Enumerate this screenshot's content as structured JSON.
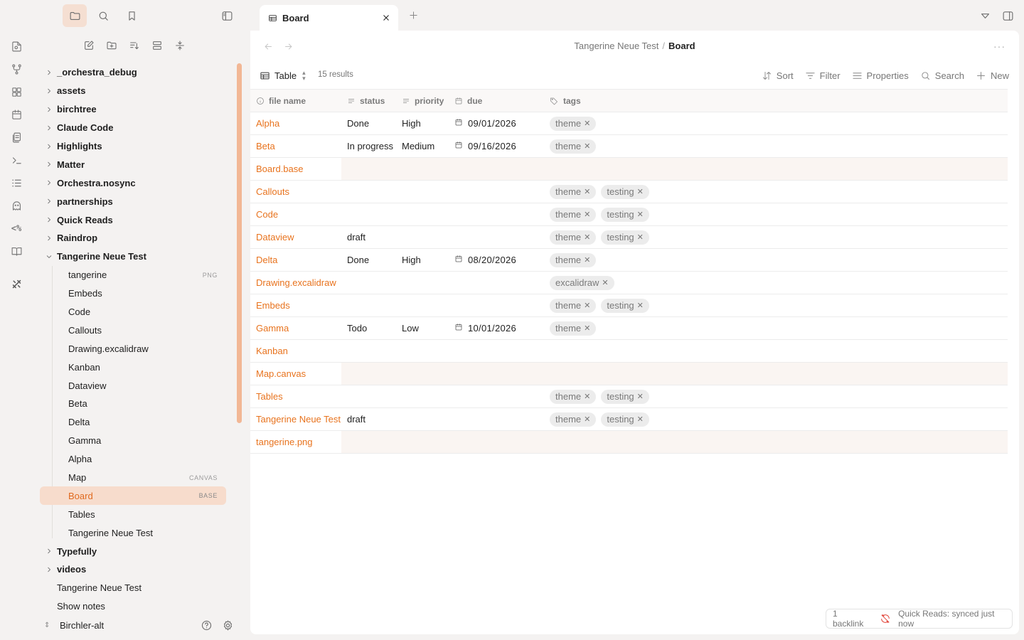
{
  "ribbon": {
    "icons": [
      "new-note-icon",
      "graph-icon",
      "dashboard-icon",
      "calendar-icon",
      "templates-icon",
      "command-icon",
      "outline-icon",
      "ghost-icon",
      "code-percent-icon",
      "book-icon",
      "tools-icon"
    ],
    "code_percent_text": "<%"
  },
  "sidebar": {
    "top_icons": [
      "folder-icon",
      "search-icon",
      "bookmark-icon"
    ],
    "tree": [
      {
        "type": "folder",
        "label": "_orchestra_debug"
      },
      {
        "type": "folder",
        "label": "assets"
      },
      {
        "type": "folder",
        "label": "birchtree"
      },
      {
        "type": "folder",
        "label": "Claude Code"
      },
      {
        "type": "folder",
        "label": "Highlights"
      },
      {
        "type": "folder",
        "label": "Matter"
      },
      {
        "type": "folder",
        "label": "Orchestra.nosync"
      },
      {
        "type": "folder",
        "label": "partnerships"
      },
      {
        "type": "folder",
        "label": "Quick Reads"
      },
      {
        "type": "folder",
        "label": "Raindrop"
      },
      {
        "type": "folder-open",
        "label": "Tangerine Neue Test"
      },
      {
        "type": "child",
        "label": "tangerine",
        "tag": "PNG"
      },
      {
        "type": "child",
        "label": "Embeds"
      },
      {
        "type": "child",
        "label": "Code"
      },
      {
        "type": "child",
        "label": "Callouts"
      },
      {
        "type": "child",
        "label": "Drawing.excalidraw"
      },
      {
        "type": "child",
        "label": "Kanban"
      },
      {
        "type": "child",
        "label": "Dataview"
      },
      {
        "type": "child",
        "label": "Beta"
      },
      {
        "type": "child",
        "label": "Delta"
      },
      {
        "type": "child",
        "label": "Gamma"
      },
      {
        "type": "child",
        "label": "Alpha"
      },
      {
        "type": "child",
        "label": "Map",
        "tag": "CANVAS"
      },
      {
        "type": "child",
        "label": "Board",
        "tag": "BASE",
        "selected": true
      },
      {
        "type": "child",
        "label": "Tables"
      },
      {
        "type": "child",
        "label": "Tangerine Neue Test"
      },
      {
        "type": "folder",
        "label": "Typefully"
      },
      {
        "type": "folder",
        "label": "videos"
      },
      {
        "type": "root-file",
        "label": "Tangerine Neue Test"
      },
      {
        "type": "root-file",
        "label": "Show notes"
      }
    ],
    "vault_name": "Birchler-alt"
  },
  "tab": {
    "label": "Board"
  },
  "breadcrumb": {
    "parent": "Tangerine Neue Test",
    "sep": "/",
    "current": "Board"
  },
  "more_label": "···",
  "toolbar": {
    "view_label": "Table",
    "results": "15 results",
    "sort": "Sort",
    "filter": "Filter",
    "properties": "Properties",
    "search": "Search",
    "new": "New"
  },
  "table": {
    "headers": {
      "name": "file name",
      "status": "status",
      "priority": "priority",
      "due": "due",
      "tags": "tags"
    },
    "rows": [
      {
        "name": "Alpha",
        "status": "Done",
        "priority": "High",
        "due": "09/01/2026",
        "tags": [
          "theme"
        ]
      },
      {
        "name": "Beta",
        "status": "In progress",
        "priority": "Medium",
        "due": "09/16/2026",
        "tags": [
          "theme"
        ]
      },
      {
        "name": "Board.base",
        "status": "",
        "priority": "",
        "due": "",
        "tags": [],
        "empty": true
      },
      {
        "name": "Callouts",
        "status": "",
        "priority": "",
        "due": "",
        "tags": [
          "theme",
          "testing"
        ]
      },
      {
        "name": "Code",
        "status": "",
        "priority": "",
        "due": "",
        "tags": [
          "theme",
          "testing"
        ]
      },
      {
        "name": "Dataview",
        "status": "draft",
        "priority": "",
        "due": "",
        "tags": [
          "theme",
          "testing"
        ]
      },
      {
        "name": "Delta",
        "status": "Done",
        "priority": "High",
        "due": "08/20/2026",
        "tags": [
          "theme"
        ]
      },
      {
        "name": "Drawing.excalidraw",
        "status": "",
        "priority": "",
        "due": "",
        "tags": [
          "excalidraw"
        ]
      },
      {
        "name": "Embeds",
        "status": "",
        "priority": "",
        "due": "",
        "tags": [
          "theme",
          "testing"
        ]
      },
      {
        "name": "Gamma",
        "status": "Todo",
        "priority": "Low",
        "due": "10/01/2026",
        "tags": [
          "theme"
        ]
      },
      {
        "name": "Kanban",
        "status": "",
        "priority": "",
        "due": "",
        "tags": []
      },
      {
        "name": "Map.canvas",
        "status": "",
        "priority": "",
        "due": "",
        "tags": [],
        "empty": true
      },
      {
        "name": "Tables",
        "status": "",
        "priority": "",
        "due": "",
        "tags": [
          "theme",
          "testing"
        ]
      },
      {
        "name": "Tangerine Neue Test",
        "status": "draft",
        "priority": "",
        "due": "",
        "tags": [
          "theme",
          "testing"
        ]
      },
      {
        "name": "tangerine.png",
        "status": "",
        "priority": "",
        "due": "",
        "tags": [],
        "empty": true
      }
    ]
  },
  "status_bar": {
    "backlinks": "1 backlink",
    "sync": "Quick Reads: synced just now"
  },
  "colors": {
    "accent": "#e8731e",
    "selected_bg": "#f7dccc",
    "sync_error": "#e2453a"
  }
}
